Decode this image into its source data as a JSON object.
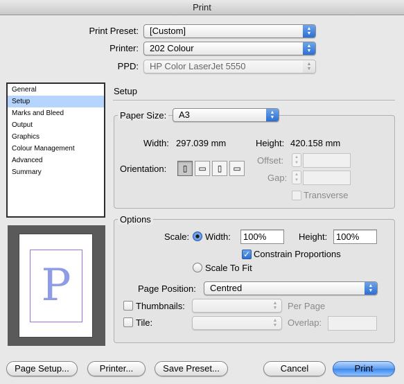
{
  "window": {
    "title": "Print"
  },
  "header": {
    "preset_label": "Print Preset:",
    "preset_value": "[Custom]",
    "printer_label": "Printer:",
    "printer_value": "202 Colour",
    "ppd_label": "PPD:",
    "ppd_value": "HP Color LaserJet 5550"
  },
  "sidebar": {
    "items": [
      {
        "label": "General"
      },
      {
        "label": "Setup"
      },
      {
        "label": "Marks and Bleed"
      },
      {
        "label": "Output"
      },
      {
        "label": "Graphics"
      },
      {
        "label": "Colour Management"
      },
      {
        "label": "Advanced"
      },
      {
        "label": "Summary"
      }
    ],
    "selected": "Setup"
  },
  "preview": {
    "letter": "P"
  },
  "setup": {
    "section_title": "Setup",
    "paper_size_label": "Paper Size:",
    "paper_size_value": "A3",
    "width_label": "Width:",
    "width_value": "297.039 mm",
    "height_label": "Height:",
    "height_value": "420.158 mm",
    "orientation_label": "Orientation:",
    "orientation_icons": [
      "portrait-icon",
      "landscape-icon",
      "reverse-portrait-icon",
      "reverse-landscape-icon"
    ],
    "offset_label": "Offset:",
    "gap_label": "Gap:",
    "transverse_label": "Transverse"
  },
  "options": {
    "group_label": "Options",
    "scale_label": "Scale:",
    "width_label": "Width:",
    "width_value": "100%",
    "height_label": "Height:",
    "height_value": "100%",
    "constrain_label": "Constrain Proportions",
    "scale_to_fit_label": "Scale To Fit",
    "page_position_label": "Page Position:",
    "page_position_value": "Centred",
    "thumbnails_label": "Thumbnails:",
    "per_page_label": "Per Page",
    "tile_label": "Tile:",
    "overlap_label": "Overlap:"
  },
  "buttons": {
    "page_setup": "Page Setup...",
    "printer": "Printer...",
    "save_preset": "Save Preset...",
    "cancel": "Cancel",
    "print": "Print"
  },
  "colors": {
    "accent": "#3d88ec",
    "list_selection": "#b5d5ff",
    "preview_margin": "#9b72e0"
  }
}
